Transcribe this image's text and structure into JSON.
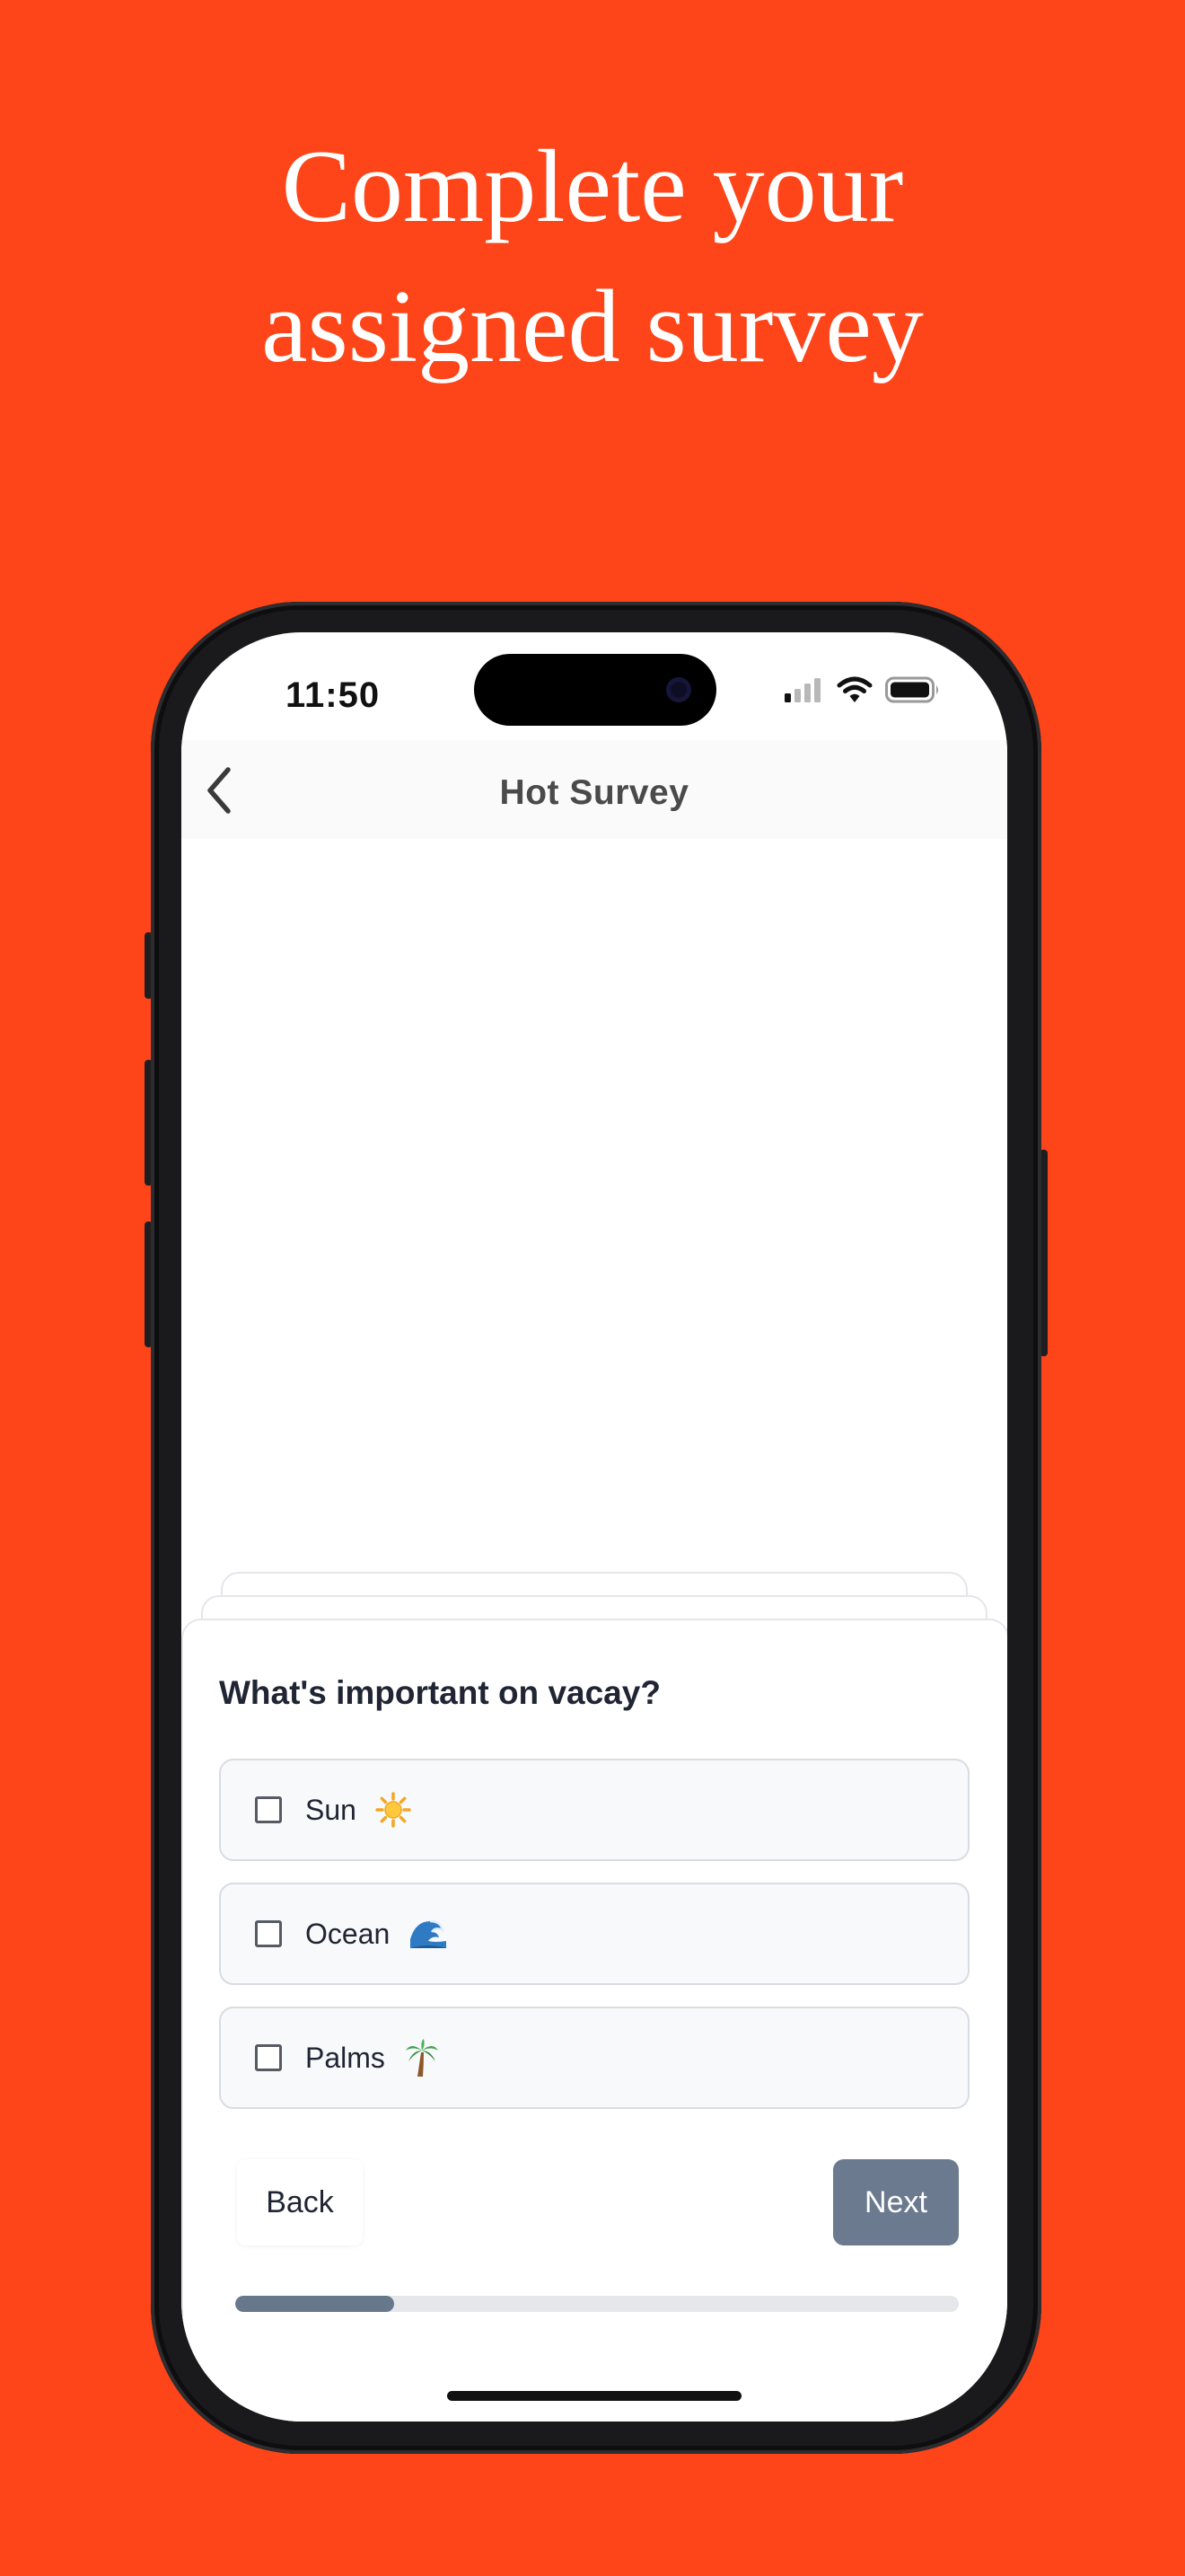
{
  "headline": {
    "line1": "Complete your",
    "line2": "assigned survey"
  },
  "status_bar": {
    "time": "11:50",
    "icons": [
      "cellular-signal-icon",
      "wifi-icon",
      "battery-icon"
    ]
  },
  "nav": {
    "back_icon": "chevron-left-icon",
    "title": "Hot Survey"
  },
  "survey": {
    "question": "What's important on vacay?",
    "options": [
      {
        "label": "Sun",
        "emoji": "☀️",
        "checked": false
      },
      {
        "label": "Ocean",
        "emoji": "🌊",
        "checked": false
      },
      {
        "label": "Palms",
        "emoji": "🌴",
        "checked": false
      }
    ],
    "back_label": "Back",
    "next_label": "Next",
    "progress": 0.22
  },
  "colors": {
    "background": "#FD4519",
    "next_button": "#6B7A8E",
    "progress_fill": "#67788C",
    "progress_track": "#E5E7EB"
  }
}
